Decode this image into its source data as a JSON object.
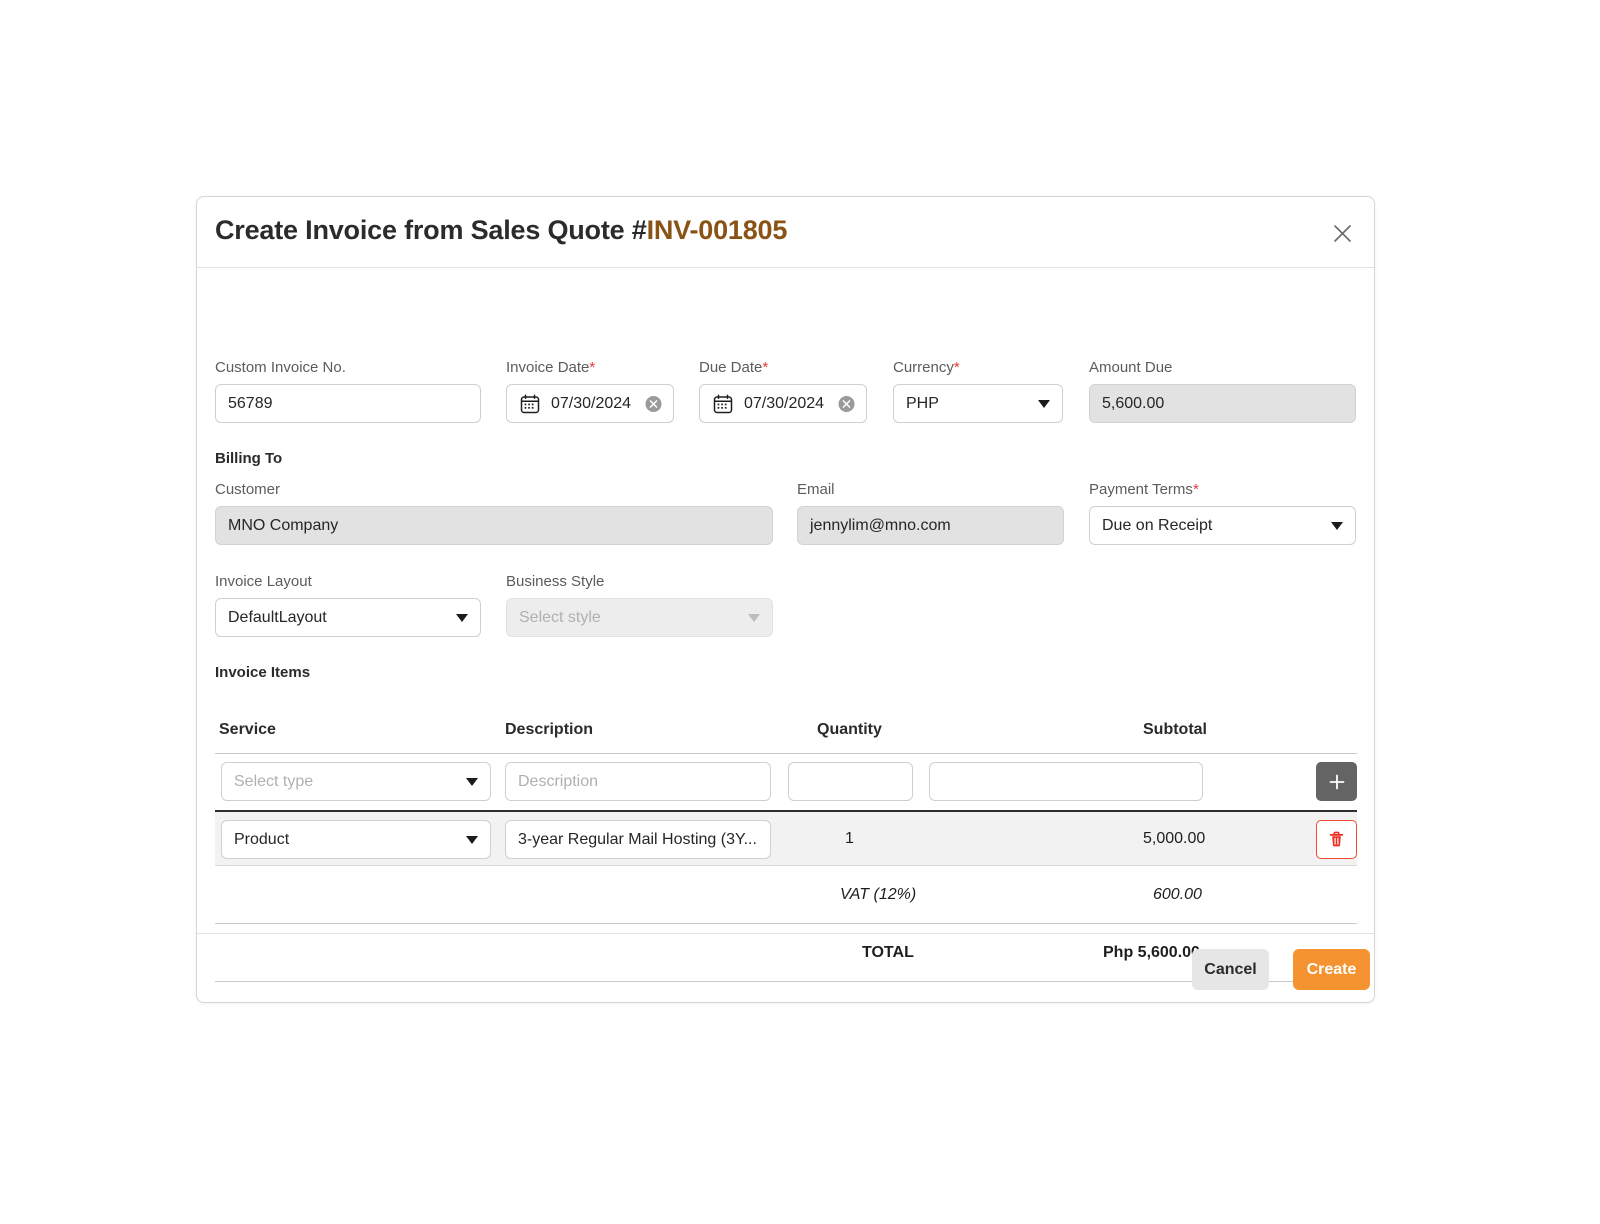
{
  "modal": {
    "title_prefix": "Create Invoice from Sales Quote #",
    "invoice_number": "INV-001805",
    "close_icon": "close-icon",
    "accent_color": "#f59331",
    "invoice_number_color": "#8a5316"
  },
  "fields": {
    "custom_invoice_no": {
      "label": "Custom Invoice No.",
      "value": "56789",
      "required": false
    },
    "invoice_date": {
      "label": "Invoice Date",
      "value": "07/30/2024",
      "required": true,
      "icon": "calendar-icon",
      "clear_icon": "clear-circle-icon"
    },
    "due_date": {
      "label": "Due Date",
      "value": "07/30/2024",
      "required": true,
      "icon": "calendar-icon",
      "clear_icon": "clear-circle-icon"
    },
    "currency": {
      "label": "Currency",
      "value": "PHP",
      "required": true
    },
    "amount_due": {
      "label": "Amount Due",
      "value": "5,600.00",
      "required": false,
      "disabled": true
    }
  },
  "billing_to": {
    "section_label": "Billing To",
    "customer": {
      "label": "Customer",
      "value": "MNO Company",
      "disabled": true
    },
    "email": {
      "label": "Email",
      "value": "jennylim@mno.com",
      "disabled": true
    },
    "payment_terms": {
      "label": "Payment Terms",
      "value": "Due on Receipt",
      "required": true
    }
  },
  "layout_row": {
    "invoice_layout": {
      "label": "Invoice Layout",
      "value": "DefaultLayout"
    },
    "business_style": {
      "label": "Business Style",
      "placeholder": "Select style",
      "value": "",
      "disabled": true
    }
  },
  "items": {
    "section_label": "Invoice Items",
    "columns": [
      "Service",
      "Description",
      "Quantity",
      "Subtotal"
    ],
    "new_row": {
      "service_placeholder": "Select type",
      "description_placeholder": "Description",
      "quantity": "",
      "subtotal": "",
      "add_button_icon": "plus-icon"
    },
    "rows": [
      {
        "service": "Product",
        "description": "3-year Regular Mail Hosting (3Y...",
        "quantity": "1",
        "subtotal": "5,000.00",
        "delete_icon": "trash-icon"
      }
    ],
    "vat": {
      "label": "VAT (12%)",
      "amount": "600.00"
    },
    "total": {
      "label": "TOTAL",
      "amount": "Php 5,600.00"
    }
  },
  "footer": {
    "cancel_label": "Cancel",
    "create_label": "Create"
  }
}
